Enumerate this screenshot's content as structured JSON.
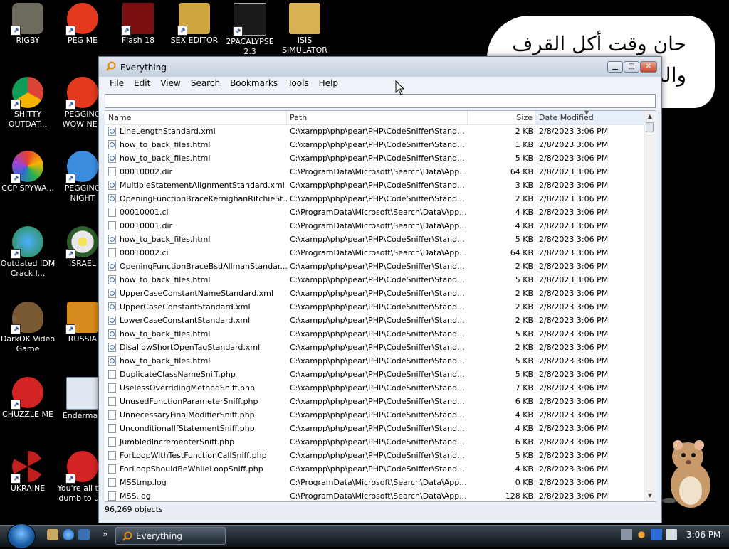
{
  "desktop": {
    "icons": [
      {
        "label": "RIGBY",
        "color": "#6f6a5e"
      },
      {
        "label": "PEG ME",
        "color": "#e5391f"
      },
      {
        "label": "Flash 18",
        "color": "#7a1010"
      },
      {
        "label": "SEX EDITOR",
        "color": "#cfa640"
      },
      {
        "label": "2PACALYPSE 2.3",
        "color": "#1b1b1b"
      },
      {
        "label": "ISIS SIMULATOR",
        "color": "#d8b155"
      },
      {
        "label": "SHITTY OUTDAT...",
        "color": "#2d8ad6"
      },
      {
        "label": "PEGGING WOW NEC",
        "color": "#e5391f"
      },
      {
        "label": "CCP SPYWA...",
        "color": "#e46f2b"
      },
      {
        "label": "PEGGING NIGHT",
        "color": "#3b8de0"
      },
      {
        "label": "Outdated IDM Crack I...",
        "color": "#2b8a3e"
      },
      {
        "label": "ISRAEL",
        "color": "#e8e8e8"
      },
      {
        "label": "DarkOK Video Game",
        "color": "#7a5a34"
      },
      {
        "label": "RUSSIA",
        "color": "#d88a1c"
      },
      {
        "label": "CHUZZLE ME",
        "color": "#d42323"
      },
      {
        "label": "Enderman",
        "color": "#dfe7f0"
      },
      {
        "label": "UKRAINE",
        "color": "#c21f1f"
      },
      {
        "label": "You're all too dumb to u...",
        "color": "#d42323"
      }
    ],
    "bubble_text_line1": "حان وقت أكل القرف",
    "bubble_text_line2": "والمو"
  },
  "window": {
    "title": "Everything",
    "controls": {
      "minimize": "▁",
      "maximize": "□",
      "close": "✕"
    },
    "menu": [
      "File",
      "Edit",
      "View",
      "Search",
      "Bookmarks",
      "Tools",
      "Help"
    ],
    "search": {
      "value": "",
      "placeholder": ""
    },
    "columns": {
      "name": "Name",
      "path": "Path",
      "size": "Size",
      "date": "Date Modified"
    },
    "rows": [
      {
        "name": "LineLengthStandard.xml",
        "path": "C:\\xampp\\php\\pear\\PHP\\CodeSniffer\\Stand...",
        "size": "2 KB",
        "date": "2/8/2023 3:06 PM",
        "icon": "web"
      },
      {
        "name": "how_to_back_files.html",
        "path": "C:\\xampp\\php\\pear\\PHP\\CodeSniffer\\Stand...",
        "size": "1 KB",
        "date": "2/8/2023 3:06 PM",
        "icon": "web"
      },
      {
        "name": "how_to_back_files.html",
        "path": "C:\\xampp\\php\\pear\\PHP\\CodeSniffer\\Stand...",
        "size": "5 KB",
        "date": "2/8/2023 3:06 PM",
        "icon": "web"
      },
      {
        "name": "00010002.dir",
        "path": "C:\\ProgramData\\Microsoft\\Search\\Data\\App...",
        "size": "64 KB",
        "date": "2/8/2023 3:06 PM",
        "icon": "file"
      },
      {
        "name": "MultipleStatementAlignmentStandard.xml",
        "path": "C:\\xampp\\php\\pear\\PHP\\CodeSniffer\\Stand...",
        "size": "3 KB",
        "date": "2/8/2023 3:06 PM",
        "icon": "web"
      },
      {
        "name": "OpeningFunctionBraceKernighanRitchieSt...",
        "path": "C:\\xampp\\php\\pear\\PHP\\CodeSniffer\\Stand...",
        "size": "2 KB",
        "date": "2/8/2023 3:06 PM",
        "icon": "web"
      },
      {
        "name": "00010001.ci",
        "path": "C:\\ProgramData\\Microsoft\\Search\\Data\\App...",
        "size": "4 KB",
        "date": "2/8/2023 3:06 PM",
        "icon": "file"
      },
      {
        "name": "00010001.dir",
        "path": "C:\\ProgramData\\Microsoft\\Search\\Data\\App...",
        "size": "4 KB",
        "date": "2/8/2023 3:06 PM",
        "icon": "file"
      },
      {
        "name": "how_to_back_files.html",
        "path": "C:\\xampp\\php\\pear\\PHP\\CodeSniffer\\Stand...",
        "size": "5 KB",
        "date": "2/8/2023 3:06 PM",
        "icon": "web"
      },
      {
        "name": "00010002.ci",
        "path": "C:\\ProgramData\\Microsoft\\Search\\Data\\App...",
        "size": "64 KB",
        "date": "2/8/2023 3:06 PM",
        "icon": "file"
      },
      {
        "name": "OpeningFunctionBraceBsdAllmanStandar...",
        "path": "C:\\xampp\\php\\pear\\PHP\\CodeSniffer\\Stand...",
        "size": "2 KB",
        "date": "2/8/2023 3:06 PM",
        "icon": "web"
      },
      {
        "name": "how_to_back_files.html",
        "path": "C:\\xampp\\php\\pear\\PHP\\CodeSniffer\\Stand...",
        "size": "5 KB",
        "date": "2/8/2023 3:06 PM",
        "icon": "web"
      },
      {
        "name": "UpperCaseConstantNameStandard.xml",
        "path": "C:\\xampp\\php\\pear\\PHP\\CodeSniffer\\Stand...",
        "size": "2 KB",
        "date": "2/8/2023 3:06 PM",
        "icon": "web"
      },
      {
        "name": "UpperCaseConstantStandard.xml",
        "path": "C:\\xampp\\php\\pear\\PHP\\CodeSniffer\\Stand...",
        "size": "2 KB",
        "date": "2/8/2023 3:06 PM",
        "icon": "web"
      },
      {
        "name": "LowerCaseConstantStandard.xml",
        "path": "C:\\xampp\\php\\pear\\PHP\\CodeSniffer\\Stand...",
        "size": "2 KB",
        "date": "2/8/2023 3:06 PM",
        "icon": "web"
      },
      {
        "name": "how_to_back_files.html",
        "path": "C:\\xampp\\php\\pear\\PHP\\CodeSniffer\\Stand...",
        "size": "5 KB",
        "date": "2/8/2023 3:06 PM",
        "icon": "web"
      },
      {
        "name": "DisallowShortOpenTagStandard.xml",
        "path": "C:\\xampp\\php\\pear\\PHP\\CodeSniffer\\Stand...",
        "size": "2 KB",
        "date": "2/8/2023 3:06 PM",
        "icon": "web"
      },
      {
        "name": "how_to_back_files.html",
        "path": "C:\\xampp\\php\\pear\\PHP\\CodeSniffer\\Stand...",
        "size": "5 KB",
        "date": "2/8/2023 3:06 PM",
        "icon": "web"
      },
      {
        "name": "DuplicateClassNameSniff.php",
        "path": "C:\\xampp\\php\\pear\\PHP\\CodeSniffer\\Stand...",
        "size": "5 KB",
        "date": "2/8/2023 3:06 PM",
        "icon": "file"
      },
      {
        "name": "UselessOverridingMethodSniff.php",
        "path": "C:\\xampp\\php\\pear\\PHP\\CodeSniffer\\Stand...",
        "size": "7 KB",
        "date": "2/8/2023 3:06 PM",
        "icon": "file"
      },
      {
        "name": "UnusedFunctionParameterSniff.php",
        "path": "C:\\xampp\\php\\pear\\PHP\\CodeSniffer\\Stand...",
        "size": "6 KB",
        "date": "2/8/2023 3:06 PM",
        "icon": "file"
      },
      {
        "name": "UnnecessaryFinalModifierSniff.php",
        "path": "C:\\xampp\\php\\pear\\PHP\\CodeSniffer\\Stand...",
        "size": "4 KB",
        "date": "2/8/2023 3:06 PM",
        "icon": "file"
      },
      {
        "name": "UnconditionalIfStatementSniff.php",
        "path": "C:\\xampp\\php\\pear\\PHP\\CodeSniffer\\Stand...",
        "size": "4 KB",
        "date": "2/8/2023 3:06 PM",
        "icon": "file"
      },
      {
        "name": "JumbledIncrementerSniff.php",
        "path": "C:\\xampp\\php\\pear\\PHP\\CodeSniffer\\Stand...",
        "size": "6 KB",
        "date": "2/8/2023 3:06 PM",
        "icon": "file"
      },
      {
        "name": "ForLoopWithTestFunctionCallSniff.php",
        "path": "C:\\xampp\\php\\pear\\PHP\\CodeSniffer\\Stand...",
        "size": "5 KB",
        "date": "2/8/2023 3:06 PM",
        "icon": "file"
      },
      {
        "name": "ForLoopShouldBeWhileLoopSniff.php",
        "path": "C:\\xampp\\php\\pear\\PHP\\CodeSniffer\\Stand...",
        "size": "4 KB",
        "date": "2/8/2023 3:06 PM",
        "icon": "file"
      },
      {
        "name": "MSStmp.log",
        "path": "C:\\ProgramData\\Microsoft\\Search\\Data\\App...",
        "size": "0 KB",
        "date": "2/8/2023 3:06 PM",
        "icon": "file"
      },
      {
        "name": "MSS.log",
        "path": "C:\\ProgramData\\Microsoft\\Search\\Data\\App...",
        "size": "128 KB",
        "date": "2/8/2023 3:06 PM",
        "icon": "file"
      }
    ],
    "status": "96,269 objects"
  },
  "taskbar": {
    "task_label": "Everything",
    "clock": "3:06 PM",
    "overflow": "»"
  },
  "colors": {
    "accent": "#2d6bd6",
    "window_bg": "#e9eef5",
    "taskbar": "#1d2731"
  }
}
